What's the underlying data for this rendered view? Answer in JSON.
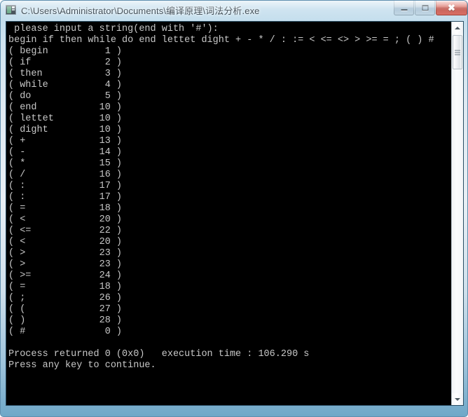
{
  "window": {
    "title": "C:\\Users\\Administrator\\Documents\\编译原理\\词法分析.exe",
    "icon": "console-app-icon",
    "frame_color": "#b9d8ea",
    "caption_buttons": [
      {
        "name": "minimize-button",
        "label": "—",
        "glyph": "minimize-icon"
      },
      {
        "name": "maximize-button",
        "label": "□",
        "glyph": "maximize-icon"
      },
      {
        "name": "close-button",
        "label": "✖",
        "glyph": "close-icon",
        "color": "#cf4b3e"
      }
    ]
  },
  "console": {
    "background_color": "#000000",
    "text_color": "#c8c8c8",
    "prompt_line": "please input a string(end with '#'):",
    "input_line": "begin if then while do end lettet dight + - * / : := < <= <> > >= = ; ( ) #",
    "tokens": [
      {
        "lexeme": "begin",
        "code": "1"
      },
      {
        "lexeme": "if",
        "code": "2"
      },
      {
        "lexeme": "then",
        "code": "3"
      },
      {
        "lexeme": "while",
        "code": "4"
      },
      {
        "lexeme": "do",
        "code": "5"
      },
      {
        "lexeme": "end",
        "code": "10"
      },
      {
        "lexeme": "lettet",
        "code": "10"
      },
      {
        "lexeme": "dight",
        "code": "10"
      },
      {
        "lexeme": "+",
        "code": "13"
      },
      {
        "lexeme": "-",
        "code": "14"
      },
      {
        "lexeme": "*",
        "code": "15"
      },
      {
        "lexeme": "/",
        "code": "16"
      },
      {
        "lexeme": ":",
        "code": "17"
      },
      {
        "lexeme": ":",
        "code": "17"
      },
      {
        "lexeme": "=",
        "code": "18"
      },
      {
        "lexeme": "<",
        "code": "20"
      },
      {
        "lexeme": "<=",
        "code": "22"
      },
      {
        "lexeme": "<",
        "code": "20"
      },
      {
        "lexeme": ">",
        "code": "23"
      },
      {
        "lexeme": ">",
        "code": "23"
      },
      {
        "lexeme": ">=",
        "code": "24"
      },
      {
        "lexeme": "=",
        "code": "18"
      },
      {
        "lexeme": ";",
        "code": "26"
      },
      {
        "lexeme": "(",
        "code": "27"
      },
      {
        "lexeme": ")",
        "code": "28"
      },
      {
        "lexeme": "#",
        "code": "0"
      }
    ],
    "exit_line": "Process returned 0 (0x0)   execution time : 106.290 s",
    "continue_line": "Press any key to continue."
  },
  "scrollbar": {
    "up_arrow": "▲",
    "down_arrow": "▼"
  }
}
